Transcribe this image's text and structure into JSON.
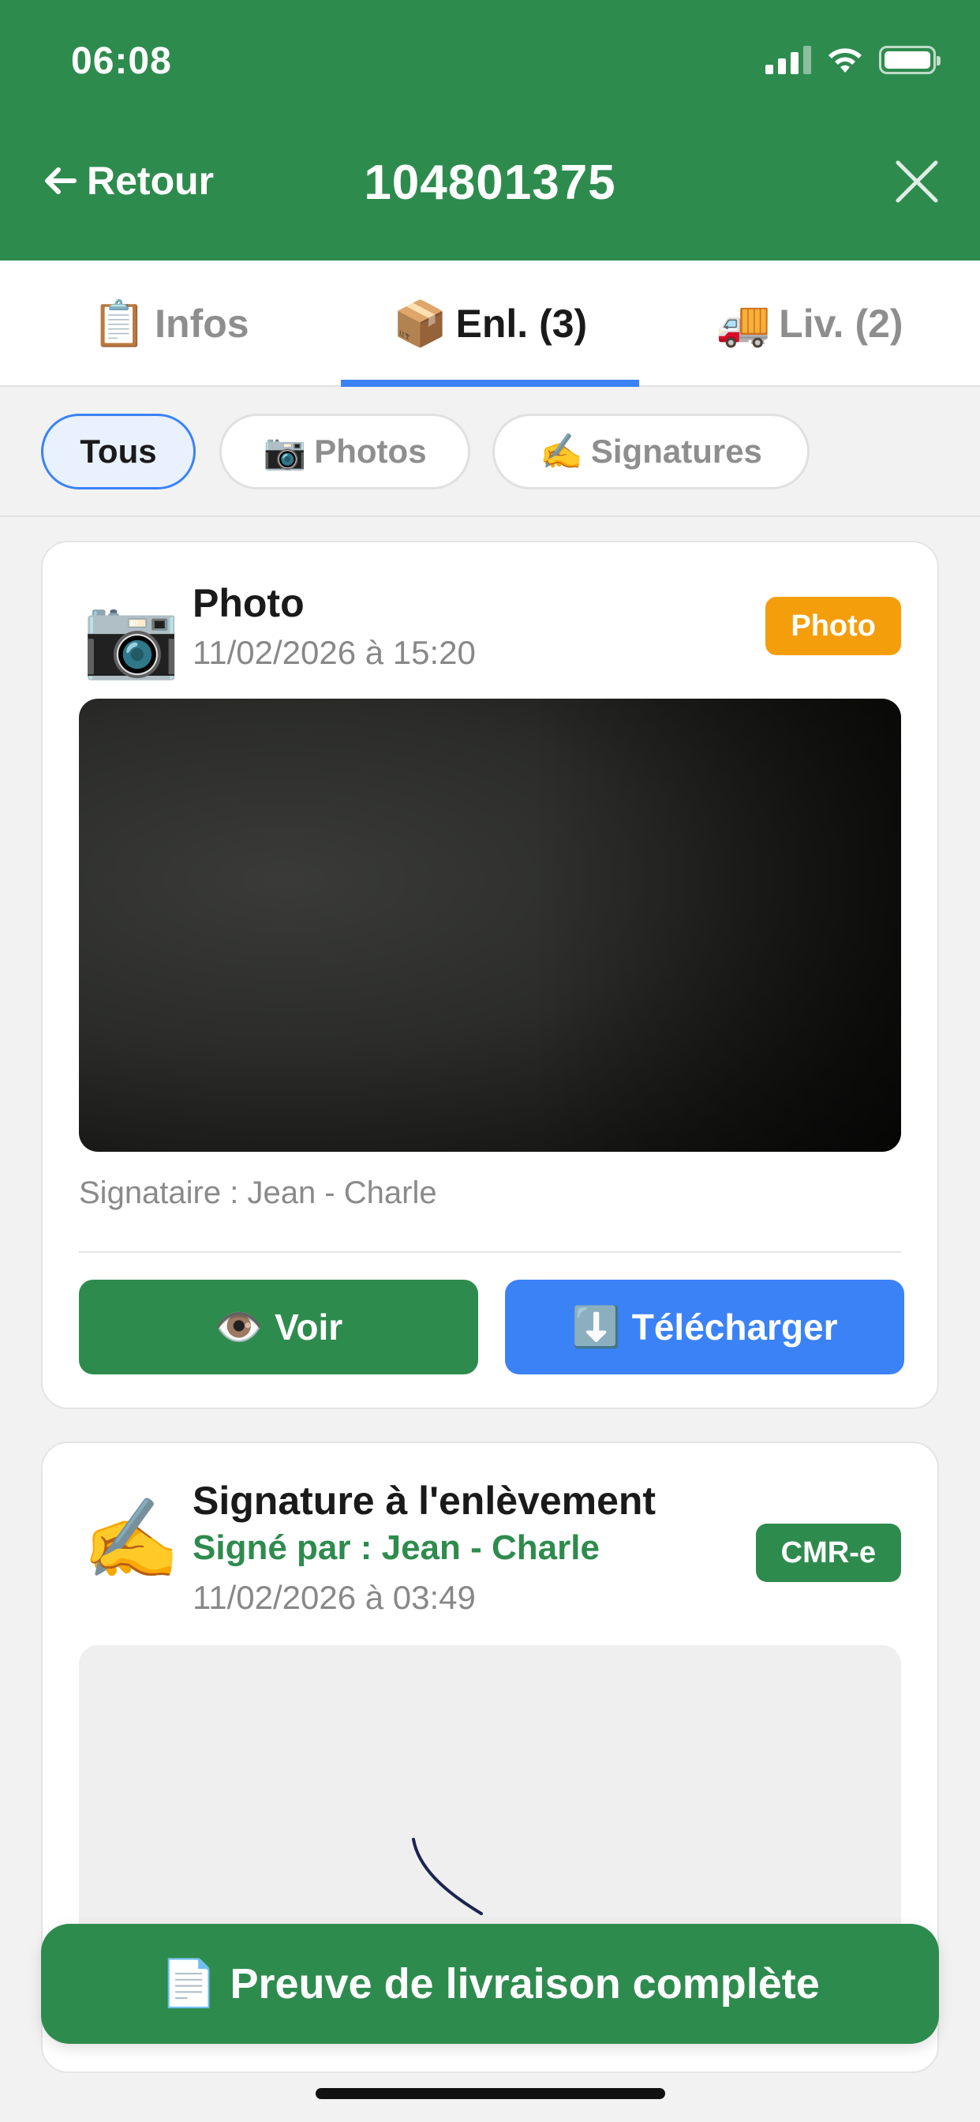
{
  "status_bar": {
    "time": "06:08",
    "icons": [
      "cellular-signal-icon",
      "wifi-icon",
      "battery-icon"
    ]
  },
  "header": {
    "back_label": "Retour",
    "title": "104801375",
    "background_color": "#2e8b4e"
  },
  "tabs": [
    {
      "emoji": "📋",
      "label": "Infos",
      "active": false
    },
    {
      "emoji": "📦",
      "label": "Enl. (3)",
      "active": true
    },
    {
      "emoji": "🚚",
      "label": "Liv. (2)",
      "active": false
    }
  ],
  "filters": [
    {
      "emoji": "",
      "label": "Tous",
      "active": true
    },
    {
      "emoji": "📷",
      "label": "Photos",
      "active": false
    },
    {
      "emoji": "✍️",
      "label": "Signatures",
      "active": false
    }
  ],
  "cards": {
    "photo": {
      "icon": "📷",
      "title": "Photo",
      "date": "11/02/2026 à 15:20",
      "badge": "Photo",
      "badge_color": "#f59e0b",
      "signataire": "Signataire : Jean - Charle",
      "view_emoji": "👁️",
      "view_label": "Voir",
      "download_emoji": "⬇️",
      "download_label": "Télécharger"
    },
    "signature": {
      "icon": "✍️",
      "title": "Signature à l'enlèvement",
      "signed_by": "Signé par : Jean - Charle",
      "date": "11/02/2026 à 03:49",
      "badge": "CMR-e",
      "badge_color": "#2e8b4e"
    }
  },
  "bottom_action": {
    "emoji": "📄",
    "label": "Preuve de livraison complète"
  },
  "colors": {
    "primary_green": "#2e8b4e",
    "accent_blue": "#3b82f6",
    "badge_orange": "#f59e0b"
  }
}
